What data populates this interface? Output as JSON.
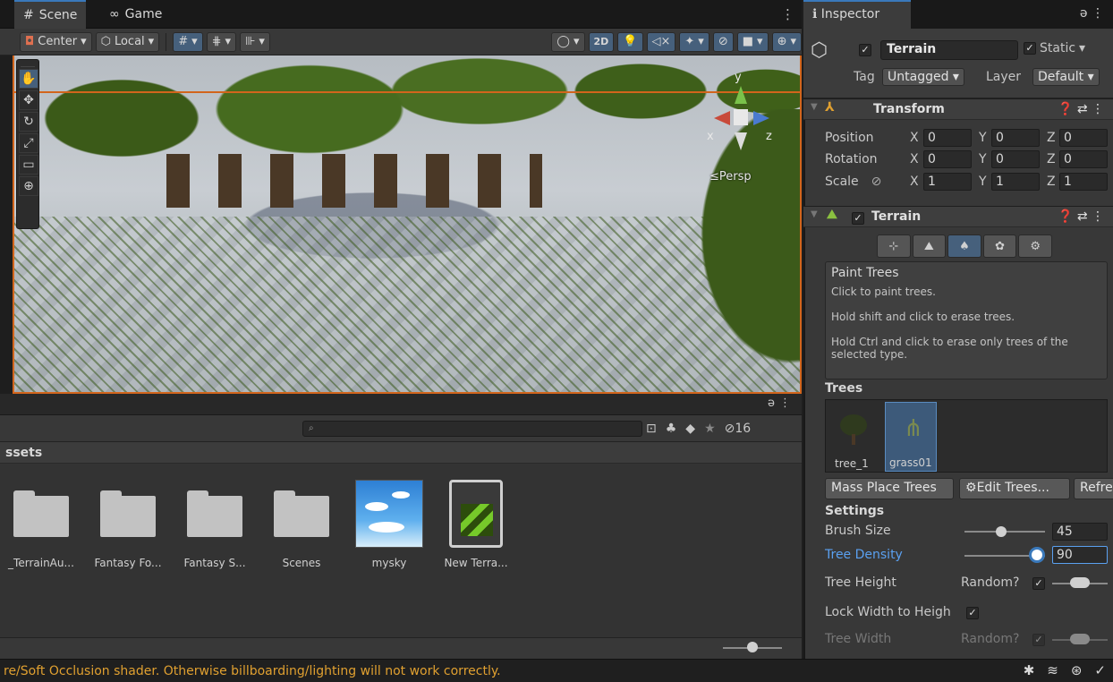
{
  "scene_tabs": {
    "scene": "Scene",
    "game": "Game"
  },
  "scene_toolbar": {
    "pivot": "Center",
    "space": "Local",
    "mode2d": "2D"
  },
  "viewport": {
    "axis_y": "y",
    "axis_x": "x",
    "axis_z": "z",
    "projection": "Persp"
  },
  "project": {
    "search_placeholder": "",
    "hidden_count": "16",
    "breadcrumb": "ssets",
    "assets": [
      {
        "label": "_TerrainAu..."
      },
      {
        "label": "Fantasy Fo..."
      },
      {
        "label": "Fantasy S..."
      },
      {
        "label": "Scenes"
      },
      {
        "label": "mysky"
      },
      {
        "label": "New Terra..."
      }
    ],
    "zoom": 0.5
  },
  "status": {
    "message": "re/Soft Occlusion shader. Otherwise billboarding/lighting will not work correctly."
  },
  "inspector": {
    "tab": "Inspector",
    "object_name": "Terrain",
    "static_label": "Static",
    "tag_label": "Tag",
    "tag_value": "Untagged",
    "layer_label": "Layer",
    "layer_value": "Default",
    "transform": {
      "title": "Transform",
      "position_label": "Position",
      "rotation_label": "Rotation",
      "scale_label": "Scale",
      "x": "X",
      "y": "Y",
      "z": "Z",
      "position": [
        "0",
        "0",
        "0"
      ],
      "rotation": [
        "0",
        "0",
        "0"
      ],
      "scale": [
        "1",
        "1",
        "1"
      ]
    },
    "terrain": {
      "title": "Terrain",
      "help_title": "Paint Trees",
      "help_1": "Click to paint trees.",
      "help_2": "Hold shift and click to erase trees.",
      "help_3": "Hold Ctrl and click to erase only trees of the selected type.",
      "trees_header": "Trees",
      "tree_items": [
        "tree_1",
        "grass01"
      ],
      "mass_place": "Mass Place Trees",
      "edit_trees": "Edit Trees...",
      "refresh": "Refre",
      "settings_header": "Settings",
      "brush_size_label": "Brush Size",
      "brush_size": "45",
      "density_label": "Tree Density",
      "density": "90",
      "height_label": "Tree Height",
      "random_label": "Random?",
      "lock_label": "Lock Width to Heigh",
      "width_label": "Tree Width",
      "random_label2": "Random?"
    }
  },
  "colors": {
    "accent": "#3a79bb",
    "orange": "#d2651c",
    "status_text": "#e0a030",
    "density_blue": "#5aa0f0"
  }
}
